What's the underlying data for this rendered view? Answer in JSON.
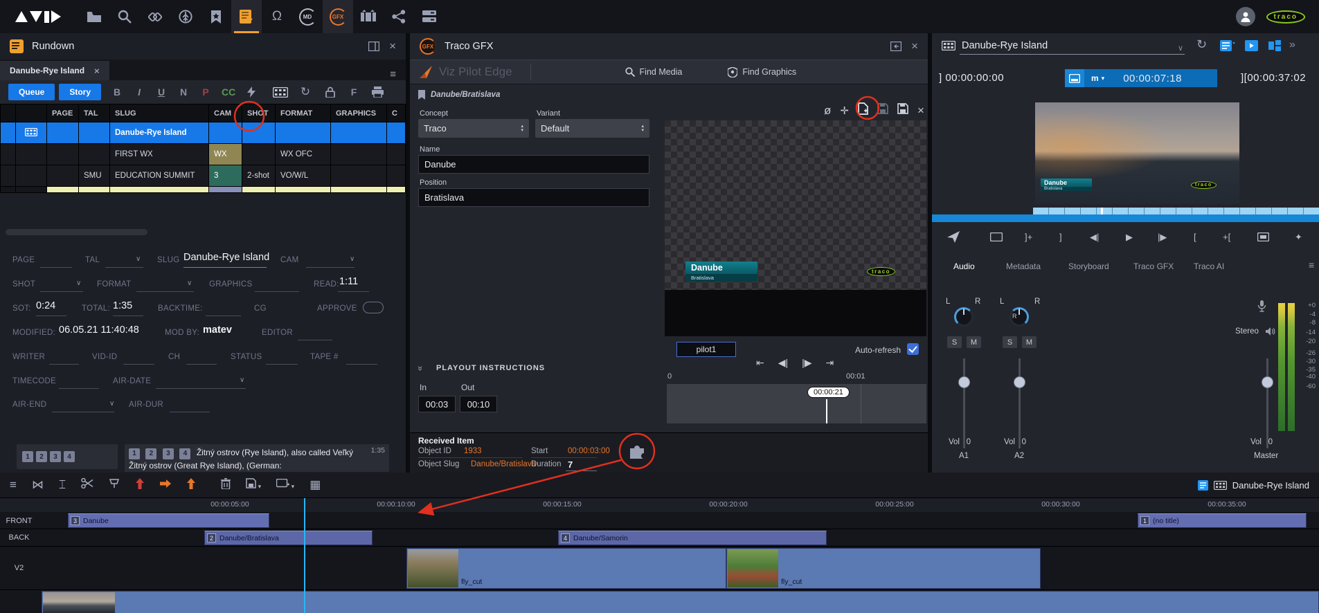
{
  "icons": {
    "menu": "≡",
    "close": "×",
    "chevron_down": "∨",
    "chevrons_right": "»",
    "omega": "Ω",
    "refresh": "↻",
    "eye_off": "ø",
    "move": "✛",
    "transition": "⋈",
    "insert": "⌶",
    "grid": "▦",
    "to_start": "⇤",
    "step_back": "◀",
    "step_fwd": "▶",
    "to_end": "⇥",
    "step_back_bar": "◀|",
    "step_fwd_bar": "|▶",
    "mark_in": "[",
    "mark_out": "]",
    "mark_in_plus": "+[",
    "mark_out_plus": "]+",
    "sparkle": "✦",
    "tri_up": "▴",
    "tri_down": "▾",
    "caret": "∨",
    "dots": "⠿"
  },
  "topbar": {
    "md": "MD",
    "gfx": "GFX",
    "traco": "traco"
  },
  "rundown": {
    "title": "Rundown",
    "tab": "Danube-Rye Island",
    "toolbar": {
      "queue": "Queue",
      "story": "Story",
      "bold": "B",
      "italic": "I",
      "underline": "U",
      "normal": "N",
      "presenter": "P",
      "cc": "CC",
      "f": "F"
    },
    "table": {
      "headers": {
        "page": "PAGE",
        "tal": "TAL",
        "slug": "SLUG",
        "cam": "CAM",
        "shot": "SHOT",
        "format": "FORMAT",
        "graphics": "GRAPHICS",
        "c": "C"
      },
      "rows": [
        {
          "tal": "",
          "slug": "Danube-Rye Island",
          "cam": "",
          "shot": "",
          "format": ""
        },
        {
          "tal": "",
          "slug": "FIRST WX",
          "cam": "WX",
          "shot": "",
          "format": "WX OFC"
        },
        {
          "tal": "SMU",
          "slug": "EDUCATION SUMMIT",
          "cam": "3",
          "shot": "2-shot",
          "format": "VO/W/L"
        }
      ]
    },
    "form": {
      "page": "PAGE",
      "tal": "TAL",
      "slug": "SLUG",
      "slug_value": "Danube-Rye Island",
      "cam": "CAM",
      "shot": "SHOT",
      "format": "FORMAT",
      "graphics": "GRAPHICS",
      "read": "READ:",
      "read_value": "1:11",
      "sot": "SOT:",
      "sot_value": "0:24",
      "total": "TOTAL:",
      "total_value": "1:35",
      "backtime": "BACKTIME:",
      "cg": "CG",
      "approve": "APPROVE",
      "modified": "MODIFIED:",
      "modified_value": "06.05.21 11:40:48",
      "modby": "MOD BY:",
      "modby_value": "matev",
      "editor": "EDITOR",
      "writer": "WRITER",
      "vidid": "VID-ID",
      "ch": "CH",
      "status": "STATUS",
      "tape": "TAPE #",
      "timecode": "TIMECODE",
      "airdate": "AIR-DATE",
      "airend": "AIR-END",
      "airdur": "AIR-DUR"
    },
    "script": {
      "chips": [
        "1",
        "2",
        "3",
        "4"
      ],
      "text": "Žitný ostrov (Rye Island), also called Veľký Žitný ostrov (Great Rye Island), (German:",
      "duration": "1:35"
    }
  },
  "gfx": {
    "title": "Traco GFX",
    "brand": "Viz Pilot Edge",
    "find_media": "Find Media",
    "find_graphics": "Find Graphics",
    "breadcrumb": "Danube/Bratislava",
    "concept_label": "Concept",
    "concept_value": "Traco",
    "variant_label": "Variant",
    "variant_value": "Default",
    "name_label": "Name",
    "name_value": "Danube",
    "position_label": "Position",
    "position_value": "Bratislava",
    "preview": {
      "title": "Danube",
      "subtitle": "Bratislava",
      "logo": "traco"
    },
    "pilot": "pilot1",
    "autorefresh": "Auto-refresh",
    "ruler_start": "0",
    "ruler_end": "00:01",
    "marker": "00:00:21",
    "playout": {
      "heading": "PLAYOUT INSTRUCTIONS",
      "in_label": "In",
      "in_value": "00:03",
      "out_label": "Out",
      "out_value": "00:10"
    },
    "received": {
      "heading": "Received Item",
      "object_id_label": "Object ID",
      "object_id": "1933",
      "object_slug_label": "Object Slug",
      "object_slug": "Danube/Bratislava",
      "start_label": "Start",
      "start": "00:00:03:00",
      "duration_label": "Duration",
      "duration": "7"
    }
  },
  "media": {
    "title": "Danube-Rye Island",
    "tc_in": "00:00:00:00",
    "tc_mode": "m",
    "tc_current": "00:00:07:18",
    "tc_out_a": "][",
    "tc_out": "00:00:37:02",
    "tc_in_bracket": "]",
    "overlay": {
      "title": "Danube",
      "subtitle": "Bratislava",
      "logo": "traco"
    },
    "tabs": [
      "Audio",
      "Metadata",
      "Storyboard",
      "Traco GFX",
      "Traco AI"
    ],
    "audio": {
      "l": "L",
      "r": "R",
      "s": "S",
      "m": "M",
      "vol_label": "Vol",
      "vol_value": "0",
      "ch1": "A1",
      "ch2": "A2",
      "master": "Master",
      "stereo": "Stereo",
      "db_scale": [
        "+0",
        "-4",
        "-8",
        "-14",
        "-20",
        "-26",
        "-30",
        "-35",
        "-40",
        "-60"
      ]
    }
  },
  "timeline": {
    "clip_title": "Danube-Rye Island",
    "ruler": [
      "00:00:05:00",
      "00:00:10:00",
      "00:00:15:00",
      "00:00:20:00",
      "00:00:25:00",
      "00:00:30:00",
      "00:00:35:00"
    ],
    "tracks": {
      "front": "FRONT",
      "back": "BACK",
      "v2": "V2"
    },
    "clips": {
      "danube": {
        "badge": "3",
        "name": "Danube"
      },
      "notitle": {
        "badge": "1",
        "name": "(no title)"
      },
      "bratislava": {
        "badge": "2",
        "name": "Danube/Bratislava"
      },
      "samorin": {
        "badge": "4",
        "name": "Danube/Samorin"
      },
      "fly1": {
        "name": "fly_cut"
      },
      "fly2": {
        "name": "fly_cut"
      }
    }
  }
}
